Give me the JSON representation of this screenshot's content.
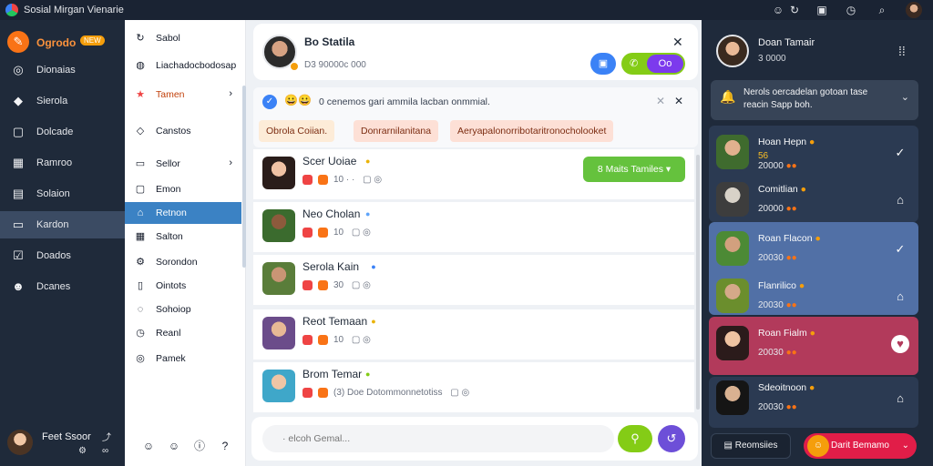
{
  "window": {
    "title": "Sosial Mirgan Vienarie"
  },
  "titlebar_icons": [
    "emoji-icon",
    "refresh-icon",
    "briefcase-icon",
    "clock-icon",
    "search-icon"
  ],
  "brand": {
    "label": "Ogrodo",
    "badge": "NEW"
  },
  "leftnav": [
    {
      "label": "Dionaias",
      "icon": "compass-icon",
      "active": false
    },
    {
      "label": "Sierola",
      "icon": "tag-icon",
      "active": false
    },
    {
      "label": "Dolcade",
      "icon": "page-icon",
      "active": false
    },
    {
      "label": "Ramroo",
      "icon": "grid-icon",
      "active": false
    },
    {
      "label": "Solaion",
      "icon": "clipboard-icon",
      "active": false
    },
    {
      "label": "Kardon",
      "icon": "square-icon",
      "active": true
    },
    {
      "label": "Doados",
      "icon": "check-box-icon",
      "active": false
    },
    {
      "label": "Dcanes",
      "icon": "people-icon",
      "active": false
    }
  ],
  "user": {
    "name": "Feet Ssoor"
  },
  "subnav": [
    {
      "label": "Sabol",
      "icon": "refresh-icon",
      "chevron": false,
      "active": false
    },
    {
      "label": "Liachadocbodosap",
      "icon": "globe-icon",
      "chevron": false,
      "active": false
    },
    {
      "label": "Tamen",
      "icon": "star-icon",
      "chevron": true,
      "active": false,
      "warn": true
    },
    {
      "label": "Canstos",
      "icon": "diamond-icon",
      "chevron": false,
      "active": false
    },
    {
      "label": "Sellor",
      "icon": "square-icon",
      "chevron": true,
      "active": false
    },
    {
      "label": "Emon",
      "icon": "page-icon",
      "chevron": false,
      "active": false
    },
    {
      "label": "Retnon",
      "icon": "home-icon",
      "chevron": false,
      "active": true
    },
    {
      "label": "Salton",
      "icon": "grid-icon",
      "chevron": false,
      "active": false
    },
    {
      "label": "Sorondon",
      "icon": "gear-icon",
      "chevron": false,
      "active": false
    },
    {
      "label": "Ointots",
      "icon": "tablet-icon",
      "chevron": false,
      "active": false
    },
    {
      "label": "Sohoiop",
      "icon": "ring-icon",
      "chevron": false,
      "active": false
    },
    {
      "label": "Reanl",
      "icon": "clock-icon",
      "chevron": false,
      "active": false
    },
    {
      "label": "Pamek",
      "icon": "compass-icon",
      "chevron": false,
      "active": false
    }
  ],
  "chat_header": {
    "name": "Bo Statila",
    "sub": "D3 90000c 000"
  },
  "notice": {
    "text": "0 cenemos gari ammila lacban onmmial.",
    "tags": [
      "Obrola Coiian.",
      "Donrarnilanitana",
      "Aeryapalonorribotaritronocholooket"
    ]
  },
  "messages": [
    {
      "name": "Scer Uoiae",
      "stat": "10 · ·",
      "status_color": "#eab308",
      "button": "8 Maits Tamiles"
    },
    {
      "name": "Neo Cholan",
      "stat": "10",
      "status_color": "#60a5fa"
    },
    {
      "name": "Serola Kain",
      "stat": "30",
      "status_color": "#3b82f6"
    },
    {
      "name": "Reot Temaan",
      "stat": "10",
      "status_color": "#eab308"
    },
    {
      "name": "Brom Temar",
      "stat": "(3)  Doe Dotommonnetotiss",
      "status_color": "#84cc16"
    }
  ],
  "composer": {
    "placeholder": "· elcoh Gemal..."
  },
  "right_panel": {
    "user": {
      "name": "Doan Tamair",
      "sub": "3 0000"
    },
    "notice": "Nerols oercadelan gotoan tase reacin Sapp boh.",
    "contacts": [
      {
        "name": "Hoan Hepn",
        "sub": "20000",
        "tag": "56"
      },
      {
        "name": "Comitlian",
        "sub": "20000"
      },
      {
        "name": "Roan Flacon",
        "sub": "20030"
      },
      {
        "name": "Flanrilico",
        "sub": "20030"
      },
      {
        "name": "Roan Fialm",
        "sub": "20030"
      },
      {
        "name": "Sdeoitnoon",
        "sub": "20030"
      }
    ],
    "footer_left": "Reomsiies",
    "footer_right": "Darit Bemamo"
  }
}
